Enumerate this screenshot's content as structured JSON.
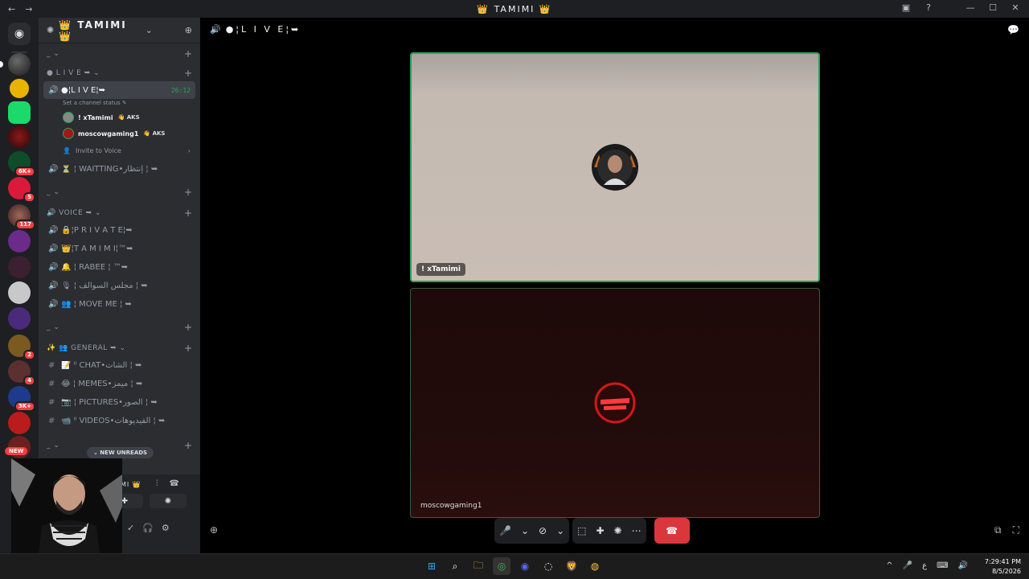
{
  "titlebar": {
    "title": "👑 TAMIMI 👑",
    "back": "←",
    "forward": "→",
    "inbox_icon": "▣",
    "help_icon": "?",
    "minimize": "—",
    "maximize": "☐",
    "close": "✕"
  },
  "rail": {
    "home_glyph": "◉",
    "badges": [
      "6K+",
      "5",
      "117",
      "2",
      "4",
      "3K+"
    ],
    "new_label": "NEW"
  },
  "guild": {
    "name": "👑 TAMIMI 👑",
    "chevron": "⌄",
    "add_member_icon": "⊕"
  },
  "categories": {
    "c1": "_ ⌄",
    "live": "● L I V E ➥ ⌄",
    "c3": "_ ⌄",
    "voice": "🔊 VOICE ➥ ⌄",
    "c5": "_ ⌄",
    "general": "✨ 👥 GENERAL ➥ ⌄",
    "c7": "_ ⌄"
  },
  "channels": {
    "live": {
      "label": "●¦L I V E¦➥",
      "time": "26:12"
    },
    "status": "Set a channel status ✎",
    "voice_users": [
      {
        "name": "! xTamimi",
        "tag": "👋 AKS"
      },
      {
        "name": "moscowgaming1",
        "tag": "👋 AKS"
      }
    ],
    "invite": "Invite to Voice",
    "waiting": "⏳ ¦ WAITTING•إنتظار ¦ ➥",
    "private": "🔒¦P R I V A T E¦➥",
    "tamimi": "👑¦T A M I M I¦™➥",
    "rabee": "🔔 ¦ RABEE ¦ ™➥",
    "sawalef": "🎙 ¦ مجلس السوالف ¦ ➥",
    "moveme": "👥 ¦ MOVE ME ¦ ➥",
    "chat": "📝 ᴵᴵ CHAT•الشات ¦ ➥",
    "memes": "😂 ¦ MEMES•ميمز ¦ ➥",
    "pictures": "📷 ¦ PICTURES•الصور ¦ ➥",
    "videos": "📹 ᴵᴵ VIDEOS•الفيديوهات ¦ ➥"
  },
  "unreads": "⌄ NEW UNREADS",
  "voice_panel": {
    "channel_name": "MI 👑",
    "wave_icon": "⫶",
    "disconnect_icon": "☎",
    "activity_icon": "✚",
    "soundboard_icon": "✺",
    "mute_icon": "✓",
    "headset_icon": "🎧",
    "settings_icon": "⚙"
  },
  "stage": {
    "channel_title": "●¦L I V E¦➥",
    "speaker_icon": "🔊",
    "chat_icon": "💬",
    "tiles": [
      {
        "name": "! xTamimi"
      },
      {
        "name": "moscowgaming1"
      }
    ],
    "controls": {
      "mic": "🎤",
      "camera_off": "⃠",
      "screen_share": "⬚",
      "activities": "✚",
      "soundboard": "✺",
      "more": "⋯",
      "hangup": "☎"
    },
    "popout_icon": "⧉",
    "fullscreen_icon": "⛶",
    "invite_icon": "⊕"
  },
  "taskbar": {
    "apps": [
      "⊞",
      "⌕",
      "🗀",
      "◎",
      "◉",
      "◌",
      "🦁",
      "◍"
    ],
    "tray": [
      "^",
      "🎤",
      "ع",
      "⌨",
      "🔊"
    ],
    "time": "7:29:41 PM",
    "date": "8/5/2026"
  },
  "colors": {
    "accent_green": "#23a55a",
    "danger_red": "#da373c",
    "sidebar_bg": "#2b2d31",
    "rail_bg": "#1e1f22"
  }
}
